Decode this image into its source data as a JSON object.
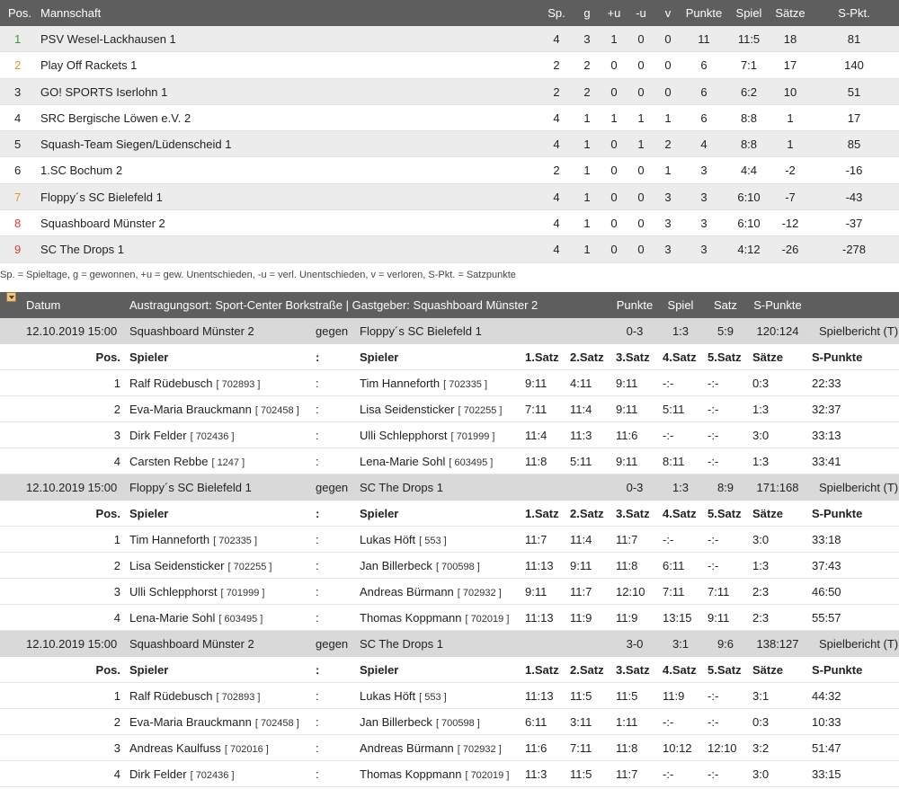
{
  "standings": {
    "headers": {
      "pos": "Pos.",
      "team": "Mannschaft",
      "sp": "Sp.",
      "g": "g",
      "pu": "+u",
      "mu": "-u",
      "v": "v",
      "punkte": "Punkte",
      "spiel": "Spiel",
      "saetze": "Sätze",
      "spkt": "S-Pkt."
    },
    "rows": [
      {
        "pos": "1",
        "team": "PSV Wesel-Lackhausen 1",
        "sp": "4",
        "g": "3",
        "pu": "1",
        "mu": "0",
        "v": "0",
        "punkte": "11",
        "spiel": "11:5",
        "saetze": "18",
        "spkt": "81",
        "pos_color": "green"
      },
      {
        "pos": "2",
        "team": "Play Off Rackets 1",
        "sp": "2",
        "g": "2",
        "pu": "0",
        "mu": "0",
        "v": "0",
        "punkte": "6",
        "spiel": "7:1",
        "saetze": "17",
        "spkt": "140",
        "pos_color": "orange"
      },
      {
        "pos": "3",
        "team": "GO! SPORTS Iserlohn 1",
        "sp": "2",
        "g": "2",
        "pu": "0",
        "mu": "0",
        "v": "0",
        "punkte": "6",
        "spiel": "6:2",
        "saetze": "10",
        "spkt": "51",
        "pos_color": "default"
      },
      {
        "pos": "4",
        "team": "SRC Bergische Löwen e.V. 2",
        "sp": "4",
        "g": "1",
        "pu": "1",
        "mu": "1",
        "v": "1",
        "punkte": "6",
        "spiel": "8:8",
        "saetze": "1",
        "spkt": "17",
        "pos_color": "default"
      },
      {
        "pos": "5",
        "team": "Squash-Team Siegen/Lüdenscheid 1",
        "sp": "4",
        "g": "1",
        "pu": "0",
        "mu": "1",
        "v": "2",
        "punkte": "4",
        "spiel": "8:8",
        "saetze": "1",
        "spkt": "85",
        "pos_color": "default"
      },
      {
        "pos": "6",
        "team": "1.SC Bochum 2",
        "sp": "2",
        "g": "1",
        "pu": "0",
        "mu": "0",
        "v": "1",
        "punkte": "3",
        "spiel": "4:4",
        "saetze": "-2",
        "spkt": "-16",
        "pos_color": "default"
      },
      {
        "pos": "7",
        "team": "Floppy´s SC Bielefeld 1",
        "sp": "4",
        "g": "1",
        "pu": "0",
        "mu": "0",
        "v": "3",
        "punkte": "3",
        "spiel": "6:10",
        "saetze": "-7",
        "spkt": "-43",
        "pos_color": "orange"
      },
      {
        "pos": "8",
        "team": "Squashboard Münster 2",
        "sp": "4",
        "g": "1",
        "pu": "0",
        "mu": "0",
        "v": "3",
        "punkte": "3",
        "spiel": "6:10",
        "saetze": "-12",
        "spkt": "-37",
        "pos_color": "red"
      },
      {
        "pos": "9",
        "team": "SC The Drops 1",
        "sp": "4",
        "g": "1",
        "pu": "0",
        "mu": "0",
        "v": "3",
        "punkte": "3",
        "spiel": "4:12",
        "saetze": "-26",
        "spkt": "-278",
        "pos_color": "red"
      }
    ],
    "legend": "Sp. = Spieltage, g = gewonnen, +u = gew. Unentschieden, -u = verl. Unentschieden, v = verloren, S-Pkt. = Satzpunkte"
  },
  "games": {
    "toggle_icon": "collapse-toggle-icon",
    "header": {
      "datum": "Datum",
      "ort": "Austragungsort: Sport-Center Borkstraße | Gastgeber: Squashboard Münster 2",
      "punkte": "Punkte",
      "spiel": "Spiel",
      "satz": "Satz",
      "spunkte": "S-Punkte"
    },
    "sub_header": {
      "pos": "Pos.",
      "spieler1": "Spieler",
      "colon": ":",
      "spieler2": "Spieler",
      "s1": "1.Satz",
      "s2": "2.Satz",
      "s3": "3.Satz",
      "s4": "4.Satz",
      "s5": "5.Satz",
      "saetze": "Sätze",
      "spunkte": "S-Punkte"
    },
    "matches": [
      {
        "date": "12.10.2019 15:00",
        "home": "Squashboard Münster 2",
        "vs": "gegen",
        "away": "Floppy´s SC Bielefeld 1",
        "punkte": "0-3",
        "spiel": "1:3",
        "satz": "5:9",
        "spunkte": "120:124",
        "report": "Spielbericht (T)",
        "players": [
          {
            "pos": "1",
            "p1": "Ralf Rüdebusch",
            "l1": "[ 702893 ]",
            "c": ":",
            "p2": "Tim Hanneforth",
            "l2": "[ 702335 ]",
            "s1": "9:11",
            "s2": "4:11",
            "s3": "9:11",
            "s4": "-:-",
            "s5": "-:-",
            "saetze": "0:3",
            "spunkte": "22:33"
          },
          {
            "pos": "2",
            "p1": "Eva-Maria Brauckmann",
            "l1": "[ 702458 ]",
            "c": ":",
            "p2": "Lisa Seidensticker",
            "l2": "[ 702255 ]",
            "s1": "7:11",
            "s2": "11:4",
            "s3": "9:11",
            "s4": "5:11",
            "s5": "-:-",
            "saetze": "1:3",
            "spunkte": "32:37"
          },
          {
            "pos": "3",
            "p1": "Dirk Felder",
            "l1": "[ 702436 ]",
            "c": ":",
            "p2": "Ulli Schlepphorst",
            "l2": "[ 701999 ]",
            "s1": "11:4",
            "s2": "11:3",
            "s3": "11:6",
            "s4": "-:-",
            "s5": "-:-",
            "saetze": "3:0",
            "spunkte": "33:13"
          },
          {
            "pos": "4",
            "p1": "Carsten Rebbe",
            "l1": "[ 1247 ]",
            "c": ":",
            "p2": "Lena-Marie Sohl",
            "l2": "[ 603495 ]",
            "s1": "11:8",
            "s2": "5:11",
            "s3": "9:11",
            "s4": "8:11",
            "s5": "-:-",
            "saetze": "1:3",
            "spunkte": "33:41"
          }
        ]
      },
      {
        "date": "12.10.2019 15:00",
        "home": "Floppy´s SC Bielefeld 1",
        "vs": "gegen",
        "away": "SC The Drops 1",
        "punkte": "0-3",
        "spiel": "1:3",
        "satz": "8:9",
        "spunkte": "171:168",
        "report": "Spielbericht (T)",
        "players": [
          {
            "pos": "1",
            "p1": "Tim Hanneforth",
            "l1": "[ 702335 ]",
            "c": ":",
            "p2": "Lukas Höft",
            "l2": "[ 553 ]",
            "s1": "11:7",
            "s2": "11:4",
            "s3": "11:7",
            "s4": "-:-",
            "s5": "-:-",
            "saetze": "3:0",
            "spunkte": "33:18"
          },
          {
            "pos": "2",
            "p1": "Lisa Seidensticker",
            "l1": "[ 702255 ]",
            "c": ":",
            "p2": "Jan Billerbeck",
            "l2": "[ 700598 ]",
            "s1": "11:13",
            "s2": "9:11",
            "s3": "11:8",
            "s4": "6:11",
            "s5": "-:-",
            "saetze": "1:3",
            "spunkte": "37:43"
          },
          {
            "pos": "3",
            "p1": "Ulli Schlepphorst",
            "l1": "[ 701999 ]",
            "c": ":",
            "p2": "Andreas Bürmann",
            "l2": "[ 702932 ]",
            "s1": "9:11",
            "s2": "11:7",
            "s3": "12:10",
            "s4": "7:11",
            "s5": "7:11",
            "saetze": "2:3",
            "spunkte": "46:50"
          },
          {
            "pos": "4",
            "p1": "Lena-Marie Sohl",
            "l1": "[ 603495 ]",
            "c": ":",
            "p2": "Thomas Koppmann",
            "l2": "[ 702019 ]",
            "s1": "11:13",
            "s2": "11:9",
            "s3": "11:9",
            "s4": "13:15",
            "s5": "9:11",
            "saetze": "2:3",
            "spunkte": "55:57"
          }
        ]
      },
      {
        "date": "12.10.2019 15:00",
        "home": "Squashboard Münster 2",
        "vs": "gegen",
        "away": "SC The Drops 1",
        "punkte": "3-0",
        "spiel": "3:1",
        "satz": "9:6",
        "spunkte": "138:127",
        "report": "Spielbericht (T)",
        "players": [
          {
            "pos": "1",
            "p1": "Ralf Rüdebusch",
            "l1": "[ 702893 ]",
            "c": ":",
            "p2": "Lukas Höft",
            "l2": "[ 553 ]",
            "s1": "11:13",
            "s2": "11:5",
            "s3": "11:5",
            "s4": "11:9",
            "s5": "-:-",
            "saetze": "3:1",
            "spunkte": "44:32"
          },
          {
            "pos": "2",
            "p1": "Eva-Maria Brauckmann",
            "l1": "[ 702458 ]",
            "c": ":",
            "p2": "Jan Billerbeck",
            "l2": "[ 700598 ]",
            "s1": "6:11",
            "s2": "3:11",
            "s3": "1:11",
            "s4": "-:-",
            "s5": "-:-",
            "saetze": "0:3",
            "spunkte": "10:33"
          },
          {
            "pos": "3",
            "p1": "Andreas Kaulfuss",
            "l1": "[ 702016 ]",
            "c": ":",
            "p2": "Andreas Bürmann",
            "l2": "[ 702932 ]",
            "s1": "11:6",
            "s2": "7:11",
            "s3": "11:8",
            "s4": "10:12",
            "s5": "12:10",
            "saetze": "3:2",
            "spunkte": "51:47"
          },
          {
            "pos": "4",
            "p1": "Dirk Felder",
            "l1": "[ 702436 ]",
            "c": ":",
            "p2": "Thomas Koppmann",
            "l2": "[ 702019 ]",
            "s1": "11:3",
            "s2": "11:5",
            "s3": "11:7",
            "s4": "-:-",
            "s5": "-:-",
            "saetze": "3:0",
            "spunkte": "33:15"
          }
        ]
      }
    ]
  }
}
